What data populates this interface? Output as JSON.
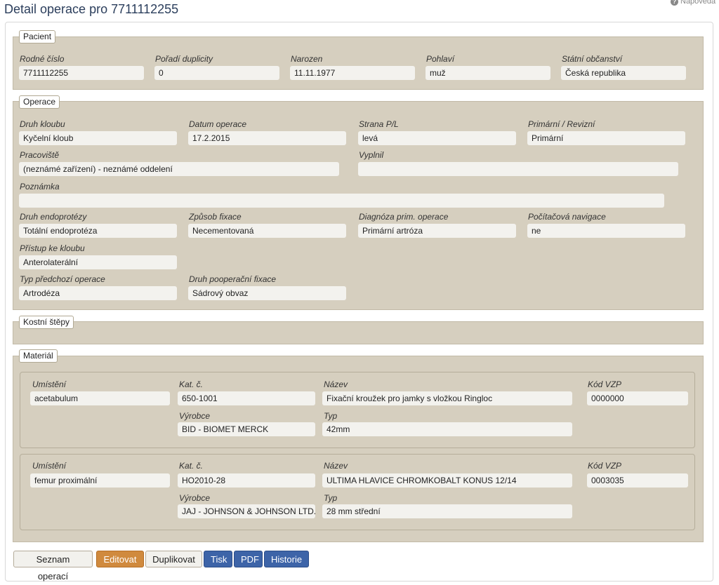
{
  "page": {
    "title": "Detail operace pro 7711112255",
    "help_label": "Nápověda",
    "help_icon": "question-circle-icon"
  },
  "patient": {
    "legend": "Pacient",
    "rc_label": "Rodné číslo",
    "rc": "7711112255",
    "dup_label": "Pořadí duplicity",
    "dup": "0",
    "born_label": "Narozen",
    "born": "11.11.1977",
    "sex_label": "Pohlaví",
    "sex": "muž",
    "citizen_label": "Státní občanství",
    "citizen": "Česká republika"
  },
  "operation": {
    "legend": "Operace",
    "joint_label": "Druh kloubu",
    "joint": "Kyčelní kloub",
    "date_label": "Datum operace",
    "date": "17.2.2015",
    "side_label": "Strana P/L",
    "side": "levá",
    "primrev_label": "Primární / Revizní",
    "primrev": "Primární",
    "workplace_label": "Pracoviště",
    "workplace": "(neznámé zařízení) - neznámé oddelení",
    "filled_label": "Vyplnil",
    "filled": "",
    "note_label": "Poznámka",
    "note": "",
    "endo_label": "Druh endoprotézy",
    "endo": "Totální endoprotéza",
    "fix_label": "Způsob fixace",
    "fix": "Necementovaná",
    "diag_label": "Diagnóza prim. operace",
    "diag": "Primární artróza",
    "nav_label": "Počítačová navigace",
    "nav": "ne",
    "access_label": "Přístup ke kloubu",
    "access": "Anterolaterální",
    "prevop_label": "Typ předchozí operace",
    "prevop": "Artrodéza",
    "postfix_label": "Druh pooperační fixace",
    "postfix": "Sádrový obvaz"
  },
  "grafts": {
    "legend": "Kostní štěpy"
  },
  "material": {
    "legend": "Materiál",
    "labels": {
      "location": "Umístění",
      "cat": "Kat. č.",
      "name": "Název",
      "vzp": "Kód VZP",
      "maker": "Výrobce",
      "type": "Typ"
    },
    "items": [
      {
        "location": "acetabulum",
        "cat": "650-1001",
        "name": "Fixační kroužek pro jamky s vložkou Ringloc",
        "vzp": "0000000",
        "maker": "BID - BIOMET MERCK",
        "type": "42mm"
      },
      {
        "location": "femur proximální",
        "cat": "HO2010-28",
        "name": "ULTIMA HLAVICE CHROMKOBALT KONUS 12/14",
        "vzp": "0003035",
        "maker": "JAJ - JOHNSON & JOHNSON LTD.",
        "type": "28 mm střední"
      }
    ]
  },
  "buttons": {
    "list": "Seznam operací",
    "edit": "Editovat",
    "duplicate": "Duplikovat",
    "print": "Tisk",
    "pdf": "PDF",
    "history": "Historie"
  }
}
